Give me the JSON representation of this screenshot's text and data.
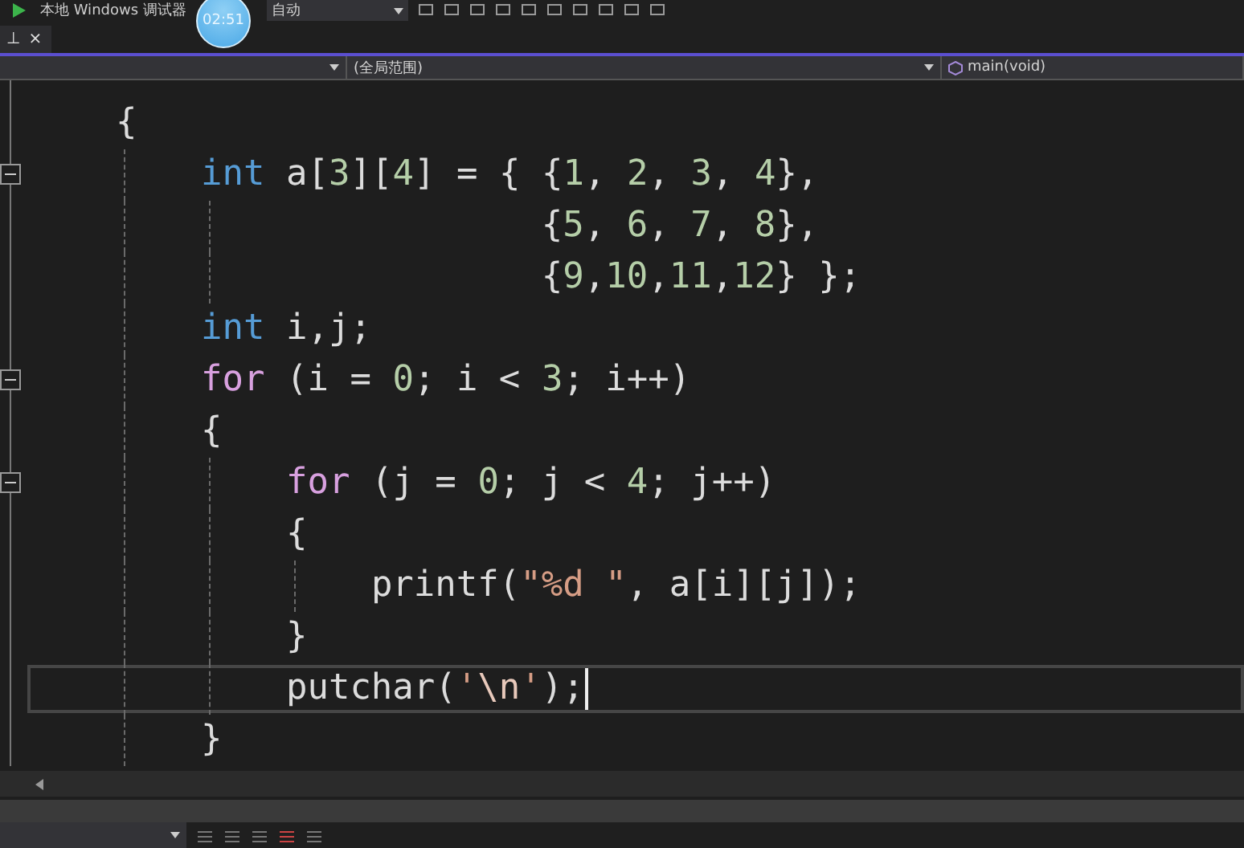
{
  "toolbar": {
    "debugger": "本地 Windows 调试器",
    "config": "自动",
    "timer": "02:51"
  },
  "tab_strip": {
    "pin": "⊥",
    "close": "×"
  },
  "nav_bar": {
    "scope": "(全局范围)",
    "function": "main(void)"
  },
  "code_lines": [
    {
      "kind": "code",
      "fold": false,
      "current": false,
      "tokens": [
        {
          "kind": "plain",
          "text": "{"
        }
      ],
      "children": [
        {
          "kind": "code",
          "fold": true,
          "current": false,
          "tokens": [
            {
              "kind": "keyword",
              "text": "int"
            },
            {
              "kind": "plain",
              "text": " a["
            },
            {
              "kind": "number",
              "text": "3"
            },
            {
              "kind": "plain",
              "text": "]["
            },
            {
              "kind": "number",
              "text": "4"
            },
            {
              "kind": "plain",
              "text": "] = { {"
            },
            {
              "kind": "number",
              "text": "1"
            },
            {
              "kind": "plain",
              "text": ", "
            },
            {
              "kind": "number",
              "text": "2"
            },
            {
              "kind": "plain",
              "text": ", "
            },
            {
              "kind": "number",
              "text": "3"
            },
            {
              "kind": "plain",
              "text": ", "
            },
            {
              "kind": "number",
              "text": "4"
            },
            {
              "kind": "plain",
              "text": "},"
            }
          ]
        },
        {
          "kind": "continuation",
          "fold": false,
          "current": false,
          "tokens": [
            {
              "kind": "plain",
              "text": "{"
            },
            {
              "kind": "number",
              "text": "5"
            },
            {
              "kind": "plain",
              "text": ", "
            },
            {
              "kind": "number",
              "text": "6"
            },
            {
              "kind": "plain",
              "text": ", "
            },
            {
              "kind": "number",
              "text": "7"
            },
            {
              "kind": "plain",
              "text": ", "
            },
            {
              "kind": "number",
              "text": "8"
            },
            {
              "kind": "plain",
              "text": "},"
            }
          ]
        },
        {
          "kind": "continuation",
          "fold": false,
          "current": false,
          "tokens": [
            {
              "kind": "plain",
              "text": "{"
            },
            {
              "kind": "number",
              "text": "9"
            },
            {
              "kind": "plain",
              "text": ","
            },
            {
              "kind": "number",
              "text": "10"
            },
            {
              "kind": "plain",
              "text": ","
            },
            {
              "kind": "number",
              "text": "11"
            },
            {
              "kind": "plain",
              "text": ","
            },
            {
              "kind": "number",
              "text": "12"
            },
            {
              "kind": "plain",
              "text": "} };"
            }
          ]
        },
        {
          "kind": "code",
          "fold": false,
          "current": false,
          "tokens": [
            {
              "kind": "keyword",
              "text": "int"
            },
            {
              "kind": "plain",
              "text": " i,j;"
            }
          ]
        },
        {
          "kind": "code",
          "fold": true,
          "current": false,
          "tokens": [
            {
              "kind": "control",
              "text": "for"
            },
            {
              "kind": "plain",
              "text": " (i = "
            },
            {
              "kind": "number",
              "text": "0"
            },
            {
              "kind": "plain",
              "text": "; i < "
            },
            {
              "kind": "number",
              "text": "3"
            },
            {
              "kind": "plain",
              "text": "; i++)"
            }
          ]
        },
        {
          "kind": "code",
          "fold": false,
          "current": false,
          "tokens": [
            {
              "kind": "plain",
              "text": "{"
            }
          ],
          "children": [
            {
              "kind": "code",
              "fold": true,
              "current": false,
              "tokens": [
                {
                  "kind": "control",
                  "text": "for"
                },
                {
                  "kind": "plain",
                  "text": " (j = "
                },
                {
                  "kind": "number",
                  "text": "0"
                },
                {
                  "kind": "plain",
                  "text": "; j < "
                },
                {
                  "kind": "number",
                  "text": "4"
                },
                {
                  "kind": "plain",
                  "text": "; j++)"
                }
              ]
            },
            {
              "kind": "code",
              "fold": false,
              "current": false,
              "tokens": [
                {
                  "kind": "plain",
                  "text": "{"
                }
              ],
              "children": [
                {
                  "kind": "code",
                  "fold": false,
                  "current": false,
                  "tokens": [
                    {
                      "kind": "plain",
                      "text": "printf("
                    },
                    {
                      "kind": "string",
                      "text": "\"%d \""
                    },
                    {
                      "kind": "plain",
                      "text": ", a[i][j]);"
                    }
                  ]
                }
              ]
            },
            {
              "kind": "code",
              "fold": false,
              "current": false,
              "tokens": [
                {
                  "kind": "plain",
                  "text": "}"
                }
              ]
            },
            {
              "kind": "code",
              "fold": false,
              "current": true,
              "tokens": [
                {
                  "kind": "plain",
                  "text": "putchar("
                },
                {
                  "kind": "string",
                  "text": "'"
                },
                {
                  "kind": "escape",
                  "text": "\\n"
                },
                {
                  "kind": "string",
                  "text": "'"
                },
                {
                  "kind": "plain",
                  "text": ");"
                }
              ]
            }
          ]
        },
        {
          "kind": "code",
          "fold": false,
          "current": false,
          "tokens": [
            {
              "kind": "plain",
              "text": "}"
            }
          ]
        }
      ]
    }
  ]
}
